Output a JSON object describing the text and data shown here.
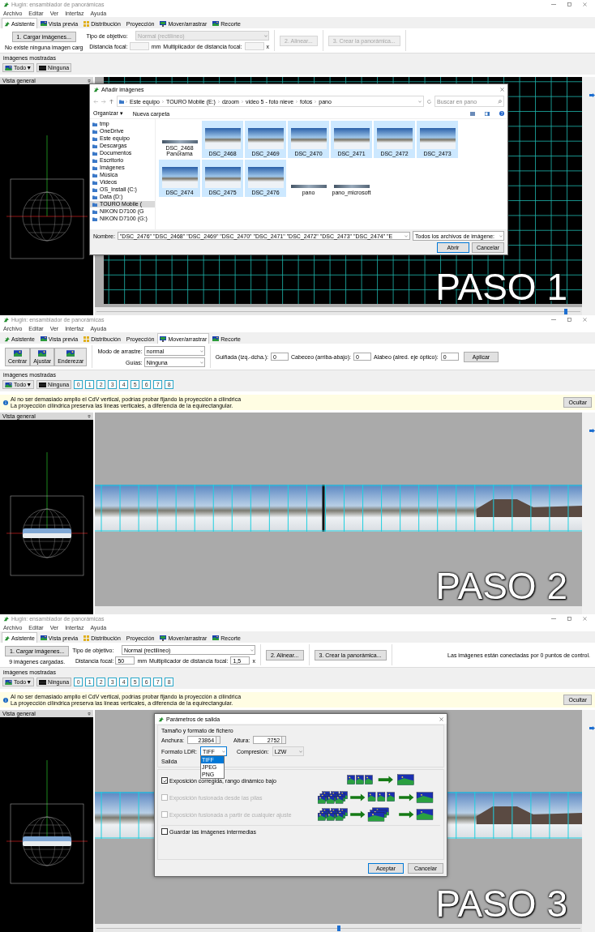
{
  "panels": [
    {
      "window_title": "Hugin: ensamblador de panorámicas",
      "menu": [
        "Archivo",
        "Editar",
        "Ver",
        "Interfaz",
        "Ayuda"
      ],
      "tabs": [
        {
          "label": "Asistente",
          "selected": true
        },
        {
          "label": "Vista previa",
          "selected": false
        },
        {
          "label": "Distribución",
          "selected": false
        },
        {
          "label": "Proyección",
          "selected": false
        },
        {
          "label": "Mover/arrastrar",
          "selected": false
        },
        {
          "label": "Recorte",
          "selected": false
        }
      ],
      "toolbar": {
        "kind": "assistant",
        "disabled": true,
        "load_button": "1. Cargar imágenes...",
        "status": "No existe ninguna imagen carg",
        "lens_label": "Tipo de objetivo:",
        "lens_value": "Normal (rectilíneo)",
        "focal_label": "Distancia focal:",
        "focal_unit": "mm",
        "multiplier_label": "Multiplicador de distancia focal:",
        "multiplier_unit": "x",
        "align_button": "2. Alinear...",
        "create_button": "3. Crear la panorámica..."
      },
      "shown_label": "imágenes mostradas",
      "all_button": "Todo▼",
      "none_button": "Ninguna",
      "overview": {
        "title": "Vista general",
        "panorama": false
      },
      "canvas": {
        "kind": "grid"
      },
      "slider": {
        "level": 0.97
      },
      "step_label": "PASO 1",
      "dialog": {
        "kind": "files",
        "title": "Añadir imágenes",
        "path": [
          "Este equipo",
          "TOURO Mobile (E:)",
          "dzoom",
          "video 5 - foto nieve",
          "fotos",
          "pano"
        ],
        "search_placeholder": "Buscar en pano",
        "organize": "Organizar ▾",
        "new_folder": "Nueva carpeta",
        "places": [
          {
            "label": "tmp",
            "selected": false
          },
          {
            "label": "OneDrive",
            "selected": false
          },
          {
            "label": "Este equipo",
            "selected": false
          },
          {
            "label": "Descargas",
            "selected": false
          },
          {
            "label": "Documentos",
            "selected": false
          },
          {
            "label": "Escritorio",
            "selected": false
          },
          {
            "label": "Imágenes",
            "selected": false
          },
          {
            "label": "Música",
            "selected": false
          },
          {
            "label": "Videos",
            "selected": false
          },
          {
            "label": "OS_Install (C:)",
            "selected": false
          },
          {
            "label": "Data (D:)",
            "selected": false
          },
          {
            "label": "TOURO Mobile (",
            "selected": true
          },
          {
            "label": "NIKON D7100 (G",
            "selected": false
          },
          {
            "label": "NIKON D7100 (G:)",
            "selected": false
          }
        ],
        "files": [
          {
            "name": "DSC_2468 Panorama",
            "kind": "strip",
            "selected": false
          },
          {
            "name": "DSC_2468",
            "kind": "photo",
            "selected": true
          },
          {
            "name": "DSC_2469",
            "kind": "photo",
            "selected": true
          },
          {
            "name": "DSC_2470",
            "kind": "photo",
            "selected": true
          },
          {
            "name": "DSC_2471",
            "kind": "photo",
            "selected": true
          },
          {
            "name": "DSC_2472",
            "kind": "photo",
            "selected": true
          },
          {
            "name": "DSC_2473",
            "kind": "photo",
            "selected": true
          },
          {
            "name": "DSC_2474",
            "kind": "photo",
            "selected": true
          },
          {
            "name": "DSC_2475",
            "kind": "photo",
            "selected": true
          },
          {
            "name": "DSC_2476",
            "kind": "photo",
            "selected": true
          },
          {
            "name": "pano",
            "kind": "strip",
            "selected": false
          },
          {
            "name": "pano_microsoft",
            "kind": "strip",
            "selected": false
          }
        ],
        "name_label": "Nombre:",
        "name_value": "\"DSC_2476\" \"DSC_2468\" \"DSC_2469\" \"DSC_2470\" \"DSC_2471\" \"DSC_2472\" \"DSC_2473\" \"DSC_2474\" \"E",
        "filter": "Todos los archivos de imágene:",
        "open_button": "Abrir",
        "cancel_button": "Cancelar"
      }
    },
    {
      "window_title": "Hugin: ensamblador de panorámicas",
      "menu": [
        "Archivo",
        "Editar",
        "Ver",
        "Interfaz",
        "Ayuda"
      ],
      "tabs": [
        {
          "label": "Asistente",
          "selected": false
        },
        {
          "label": "Vista previa",
          "selected": false
        },
        {
          "label": "Distribución",
          "selected": false
        },
        {
          "label": "Proyección",
          "selected": false
        },
        {
          "label": "Mover/arrastrar",
          "selected": true
        },
        {
          "label": "Recorte",
          "selected": false
        }
      ],
      "toolbar": {
        "kind": "drag",
        "tool_buttons": [
          "Centrar",
          "Ajustar",
          "Enderezar"
        ],
        "mode_label": "Modo de arrastre:",
        "mode_value": "normal",
        "guides_label": "Guías:",
        "guides_value": "Ninguna",
        "angles": [
          {
            "label": "Guiñada (izq.-dcha.):",
            "value": "0"
          },
          {
            "label": "Cabeceo (arriba-abajo):",
            "value": "0"
          },
          {
            "label": "Alabeo (alred. eje óptico):",
            "value": "0"
          }
        ],
        "apply_button": "Aplicar"
      },
      "shown_label": "imágenes mostradas",
      "all_button": "Todo▼",
      "none_button": "Ninguna",
      "image_buttons": [
        "0",
        "1",
        "2",
        "3",
        "4",
        "5",
        "6",
        "7",
        "8"
      ],
      "notice": {
        "lines": [
          "Al no ser demasiado amplio el CdV vertical, podrías probar fijando la proyección a cilíndrica",
          "La proyección cilíndrica preserva las líneas verticales, a diferencia de la equirectangular."
        ],
        "hide_button": "Ocultar"
      },
      "overview": {
        "title": "Vista general",
        "panorama": true
      },
      "canvas": {
        "kind": "panorama"
      },
      "step_label": "PASO 2"
    },
    {
      "window_title": "Hugin: ensamblador de panorámicas",
      "menu": [
        "Archivo",
        "Editar",
        "Ver",
        "Interfaz",
        "Ayuda"
      ],
      "tabs": [
        {
          "label": "Asistente",
          "selected": true
        },
        {
          "label": "Vista previa",
          "selected": false
        },
        {
          "label": "Distribución",
          "selected": false
        },
        {
          "label": "Proyección",
          "selected": false
        },
        {
          "label": "Mover/arrastrar",
          "selected": false
        },
        {
          "label": "Recorte",
          "selected": false
        }
      ],
      "toolbar": {
        "kind": "assistant",
        "disabled": false,
        "load_button": "1. Cargar imágenes...",
        "status": "9 imágenes cargadas.",
        "lens_label": "Tipo de objetivo:",
        "lens_value": "Normal (rectilíneo)",
        "focal_label": "Distancia focal:",
        "focal_value": "50",
        "focal_unit": "mm",
        "multiplier_label": "Multiplicador de distancia focal:",
        "multiplier_value": "1,5",
        "multiplier_unit": "x",
        "align_button": "2. Alinear...",
        "create_button": "3. Crear la panorámica...",
        "status_right": "Las imágenes están conectadas por 0 puntos de control."
      },
      "shown_label": "imágenes mostradas",
      "all_button": "Todo▼",
      "none_button": "Ninguna",
      "image_buttons": [
        "0",
        "1",
        "2",
        "3",
        "4",
        "5",
        "6",
        "7",
        "8"
      ],
      "notice": {
        "lines": [
          "Al no ser demasiado amplio el CdV vertical, podrías probar fijando la proyección a cilíndrica",
          "La proyección cilíndrica preserva las líneas verticales, a diferencia de la equirectangular."
        ],
        "hide_button": "Ocultar"
      },
      "overview": {
        "title": "Vista general",
        "panorama": true
      },
      "canvas": {
        "kind": "panorama"
      },
      "slider": {
        "level": 0.5
      },
      "step_label": "PASO 3",
      "dialog": {
        "kind": "output",
        "title": "Parámetros de salida",
        "size_section": "Tamaño y formato de fichero",
        "width_label": "Anchura:",
        "width_value": "23864",
        "height_label": "Altura:",
        "height_value": "2752",
        "format_label": "Formato LDR:",
        "format_value": "TIFF",
        "format_options": [
          {
            "label": "TIFF",
            "selected": true
          },
          {
            "label": "JPEG",
            "selected": false
          },
          {
            "label": "PNG",
            "selected": false
          }
        ],
        "compression_label": "Compresión:",
        "compression_value": "LZW",
        "output_section": "Salida",
        "outputs": [
          {
            "label": "Exposición corregida, rango dinámico bajo",
            "checked": true,
            "disabled": false,
            "kind": "simple"
          },
          {
            "label": "Exposición fusionada desde las pilas",
            "checked": false,
            "disabled": true,
            "kind": "stacks"
          },
          {
            "label": "Exposición fusionada a partir de cualquier ajuste",
            "checked": false,
            "disabled": true,
            "kind": "any"
          }
        ],
        "keep_label": "Guardar las imágenes intermedias",
        "keep_checked": false,
        "ok_button": "Aceptar",
        "cancel_button": "Cancelar"
      }
    }
  ]
}
